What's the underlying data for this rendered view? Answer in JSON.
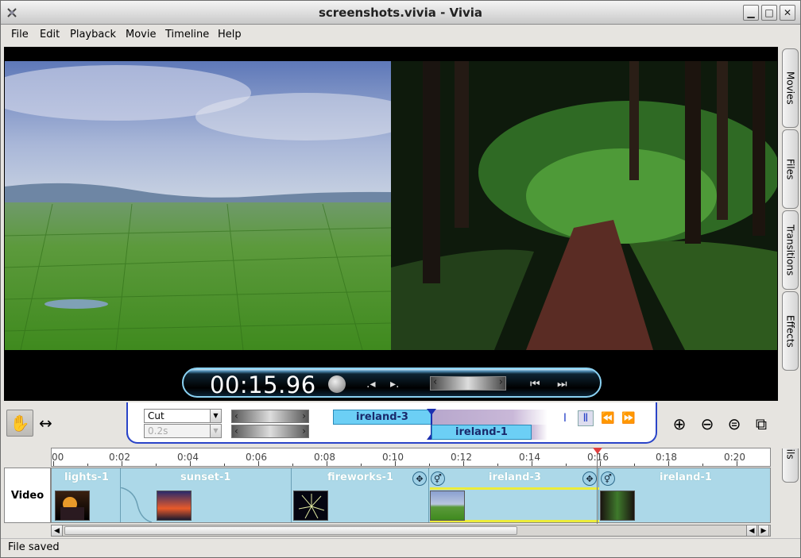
{
  "window": {
    "title": "screenshots.vivia - Vivia"
  },
  "menubar": [
    "File",
    "Edit",
    "Playback",
    "Movie",
    "Timeline",
    "Help"
  ],
  "viewer": {
    "timecode": "00:15.96"
  },
  "side_tabs": [
    "Movies",
    "Files",
    "Transitions",
    "Effects",
    "Details"
  ],
  "transition_panel": {
    "type_value": "Cut",
    "duration_value": "0.2s",
    "clip_a": "ireland-3",
    "clip_b": "ireland-1"
  },
  "timeline": {
    "ruler_ticks": [
      "00",
      "0:02",
      "0:04",
      "0:06",
      "0:08",
      "0:10",
      "0:12",
      "0:14",
      "0:16",
      "0:18",
      "0:20"
    ],
    "track_label": "Video",
    "clips": [
      "lights-1",
      "sunset-1",
      "fireworks-1",
      "ireland-3",
      "ireland-1"
    ]
  },
  "status": {
    "text": "File saved"
  },
  "colors": {
    "accent": "#2a44c8",
    "track": "#acd8e8",
    "selection": "#ecec3a",
    "playhead": "#e04040"
  }
}
